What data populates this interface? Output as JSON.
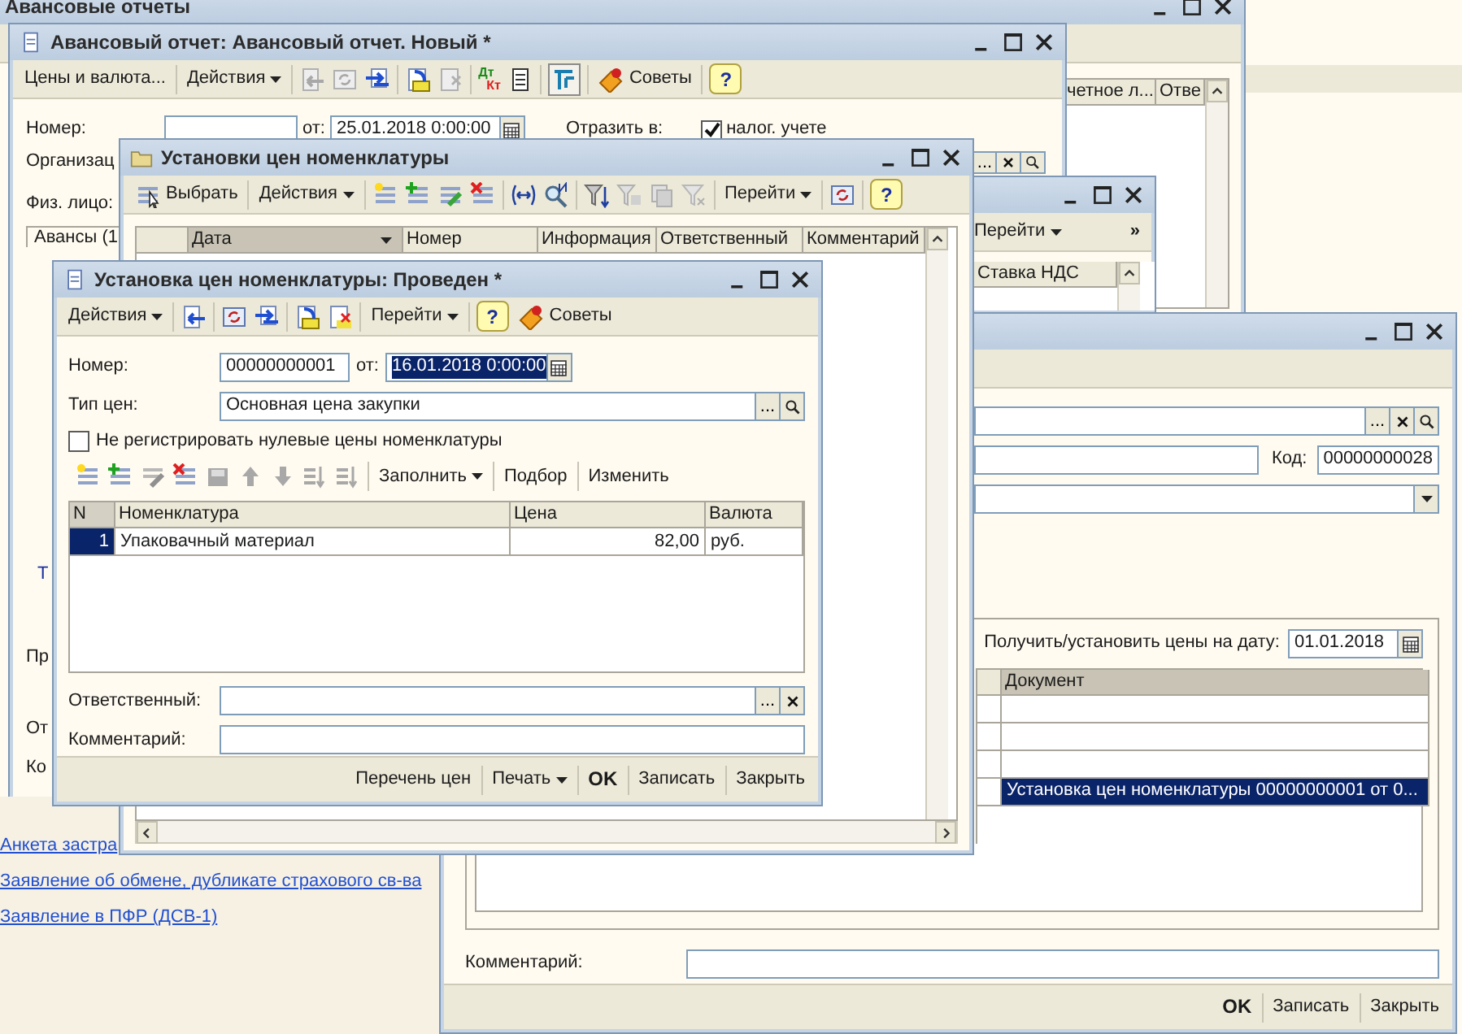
{
  "list_window": {
    "title": "Авансовые отчеты",
    "columns": [
      "четное л...",
      "Отве"
    ]
  },
  "report": {
    "title": "Авансовый отчет: Авансовый отчет. Новый *",
    "prices_button": "Цены и валюта...",
    "actions_menu": "Действия",
    "ledger": [
      "Дт",
      "Кт"
    ],
    "tips_button": "Советы",
    "help_button": "?",
    "number_label": "Номер:",
    "date_label": "от:",
    "date_value": "25.01.2018  0:00:00",
    "reflect_label": "Отразить в:",
    "tax_checkbox": {
      "label": "налог. учете",
      "checked": true
    },
    "org_label": "Организац",
    "choose_button": "...",
    "person_label": "Физ. лицо:",
    "tab": "Авансы (1",
    "cut_labels": [
      {
        "kind": "link",
        "text": "Т"
      },
      {
        "kind": "label",
        "text": "Пр"
      },
      {
        "kind": "label",
        "text": "От"
      },
      {
        "kind": "label",
        "text": "Ко"
      }
    ]
  },
  "prices_list": {
    "title": "Установки цен номенклатуры",
    "select_button": "Выбрать",
    "actions_menu": "Действия",
    "goto_menu": "Перейти",
    "help_button": "?",
    "columns": [
      {
        "label": "Дата",
        "sorted": true
      },
      {
        "label": "Номер",
        "sorted": false
      },
      {
        "label": "Информация",
        "sorted": false
      },
      {
        "label": "Ответственный",
        "sorted": false
      },
      {
        "label": "Комментарий",
        "sorted": false
      }
    ]
  },
  "side_window": {
    "goto_menu": "Перейти",
    "more_button": "»",
    "columns": [
      "Ставка НДС"
    ]
  },
  "item_window": {
    "choose_button": "...",
    "code_label": "Код:",
    "code_value": "00000000028",
    "date_label": "Получить/установить цены на дату:",
    "date_value": "01.01.2018",
    "columns": [
      "Документ"
    ],
    "rows": [
      {
        "selected": false
      },
      {
        "selected": false
      },
      {
        "selected": false
      },
      {
        "document": "Установка цен номенклатуры 00000000001 от 0...",
        "selected": true
      }
    ],
    "comment_label": "Комментарий:",
    "ok_button": "OK",
    "save_button": "Записать",
    "close_button": "Закрыть"
  },
  "price_doc": {
    "title": "Установка цен номенклатуры: Проведен *",
    "actions_menu": "Действия",
    "goto_menu": "Перейти",
    "help_button": "?",
    "tips_button": "Советы",
    "number_label": "Номер:",
    "number_value": "00000000001",
    "date_label": "от:",
    "date_value": "16.01.2018  0:00:00",
    "date_selected": true,
    "price_type_label": "Тип цен:",
    "price_type_value": "Основная цена закупки",
    "choose_button": "...",
    "zero_checkbox": {
      "label": "Не регистрировать нулевые цены номенклатуры",
      "checked": false
    },
    "fill_menu": "Заполнить",
    "pick_button": "Подбор",
    "change_button": "Изменить",
    "columns": [
      "N",
      "Номенклатура",
      "Цена",
      "Валюта"
    ],
    "rows": [
      {
        "n": "1",
        "item": "Упаковачный материал",
        "price": "82,00",
        "currency": "руб.",
        "selected": true
      }
    ],
    "responsible_label": "Ответственный:",
    "comment_label": "Комментарий:",
    "list_button": "Перечень цен",
    "print_menu": "Печать",
    "ok_button": "OK",
    "save_button": "Записать",
    "close_button": "Закрыть"
  },
  "links": [
    "Анкета застра",
    "Заявление об обмене, дубликате страхового св-ва",
    "Заявление в ПФР (ДСВ-1)"
  ]
}
